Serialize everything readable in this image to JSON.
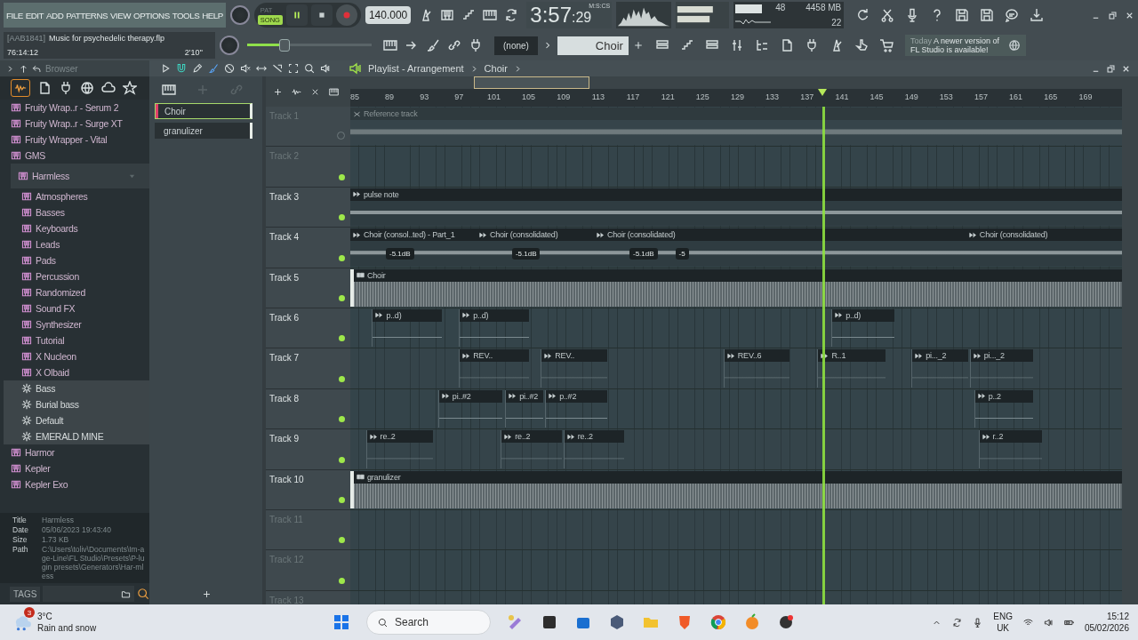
{
  "menu": [
    "FILE",
    "EDIT",
    "ADD",
    "PATTERNS",
    "VIEW",
    "OPTIONS",
    "TOOLS",
    "HELP"
  ],
  "project": {
    "code": "[AAB1841]",
    "name": "Music for psychedelic therapy.flp",
    "time": "76:14:12",
    "length": "2'10''"
  },
  "transport": {
    "modes": [
      {
        "label": "PAT",
        "selected": false
      },
      {
        "label": "SONG",
        "selected": true
      }
    ],
    "playing": true,
    "tempo": "140.000",
    "slider": {
      "level": 0.3
    }
  },
  "clock": {
    "main": "3:57",
    "small": ":29",
    "unit": "M:S:CS"
  },
  "monitor": {
    "voices": "48",
    "memory": "4458 MB",
    "cpu": "22"
  },
  "pattern": {
    "selector": "(none)",
    "current": "Choir"
  },
  "news": {
    "when": "Today",
    "text": "A newer version of FL Studio is available!"
  },
  "browser": {
    "title": "Browser",
    "items": [
      {
        "label": "Fruity Wrap..r - Serum 2",
        "kind": "plugin",
        "selected": false
      },
      {
        "label": "Fruity Wrap..r - Surge XT",
        "kind": "plugin",
        "selected": false
      },
      {
        "label": "Fruity Wrapper - Vital",
        "kind": "plugin",
        "selected": false
      },
      {
        "label": "GMS",
        "kind": "plugin",
        "selected": false
      },
      {
        "label": "Harmless",
        "kind": "plugin",
        "selected": true,
        "expanded": true,
        "children": [
          {
            "label": "Atmospheres",
            "kind": "plugin",
            "selected": false
          },
          {
            "label": "Basses",
            "kind": "plugin",
            "selected": false
          },
          {
            "label": "Keyboards",
            "kind": "plugin",
            "selected": false
          },
          {
            "label": "Leads",
            "kind": "plugin",
            "selected": false
          },
          {
            "label": "Pads",
            "kind": "plugin",
            "selected": false
          },
          {
            "label": "Percussion",
            "kind": "plugin",
            "selected": false
          },
          {
            "label": "Randomized",
            "kind": "plugin",
            "selected": false
          },
          {
            "label": "Sound FX",
            "kind": "plugin",
            "selected": false
          },
          {
            "label": "Synthesizer",
            "kind": "plugin",
            "selected": false
          },
          {
            "label": "Tutorial",
            "kind": "plugin",
            "selected": false
          },
          {
            "label": "X Nucleon",
            "kind": "plugin",
            "selected": false
          },
          {
            "label": "X Olbaid",
            "kind": "plugin",
            "selected": false
          },
          {
            "label": "Bass",
            "kind": "preset",
            "selected": false
          },
          {
            "label": "Burial bass",
            "kind": "preset",
            "selected": false
          },
          {
            "label": "Default",
            "kind": "preset",
            "selected": false
          },
          {
            "label": "EMERALD MINE",
            "kind": "preset",
            "selected": false
          }
        ]
      },
      {
        "label": "Harmor",
        "kind": "plugin",
        "selected": false
      },
      {
        "label": "Kepler",
        "kind": "plugin",
        "selected": false
      },
      {
        "label": "Kepler Exo",
        "kind": "plugin",
        "selected": false
      }
    ],
    "info": [
      {
        "label": "Title",
        "value": "Harmless"
      },
      {
        "label": "Date",
        "value": "05/06/2023 19:43:40"
      },
      {
        "label": "Size",
        "value": "1.73 KB"
      },
      {
        "label": "Path",
        "value": "C:\\Users\\toliv\\Documents\\Im-age-Line\\FL Studio\\Presets\\P-lugin presets\\Generators\\Har-mless"
      }
    ],
    "tags": "TAGS"
  },
  "picker": [
    {
      "name": "Choir",
      "selected": true
    },
    {
      "name": "granulizer",
      "selected": false
    }
  ],
  "playlist": {
    "title": "Playlist - Arrangement",
    "crumb": "Choir",
    "ruler": [
      "85",
      "89",
      "93",
      "97",
      "101",
      "105",
      "109",
      "113",
      "117",
      "121",
      "125",
      "129",
      "133",
      "137",
      "141",
      "145",
      "149",
      "153",
      "157",
      "161",
      "165",
      "169"
    ],
    "tracks": [
      {
        "name": "Track 1",
        "muted": true,
        "clips": [
          {
            "kind": "audio",
            "label": "Reference track"
          }
        ]
      },
      {
        "name": "Track 2",
        "muted": false
      },
      {
        "name": "Track 3",
        "muted": false,
        "clips": [
          {
            "kind": "audio",
            "label": "pulse note"
          }
        ]
      },
      {
        "name": "Track 4",
        "muted": false,
        "clips": [
          {
            "kind": "audio",
            "label": "Choir (consol..ted) - Part_1",
            "badges": [
              "-5.1dB"
            ]
          },
          {
            "kind": "audio",
            "label": "Choir (consolidated)",
            "badges": [
              "-5.1dB"
            ]
          },
          {
            "kind": "audio",
            "label": "Choir (consolidated)",
            "badges": [
              "-5.1dB",
              "-5"
            ]
          },
          {
            "kind": "audio",
            "label": "Choir (consolidated)"
          }
        ]
      },
      {
        "name": "Track 5",
        "muted": false,
        "clips": [
          {
            "kind": "dense",
            "label": "Choir"
          }
        ]
      },
      {
        "name": "Track 6",
        "muted": false,
        "clips": [
          {
            "kind": "pattern",
            "label": "p..d)"
          },
          {
            "kind": "pattern",
            "label": "p..d)"
          },
          {
            "kind": "pattern",
            "label": "p..d)"
          }
        ]
      },
      {
        "name": "Track 7",
        "muted": false,
        "clips": [
          {
            "kind": "pattern",
            "label": "REV.."
          },
          {
            "kind": "pattern",
            "label": "REV.."
          },
          {
            "kind": "pattern",
            "label": "REV..6"
          },
          {
            "kind": "pattern",
            "label": "R..1"
          },
          {
            "kind": "pattern",
            "label": "pi..._2"
          },
          {
            "kind": "pattern",
            "label": "pi..._2"
          }
        ]
      },
      {
        "name": "Track 8",
        "muted": false,
        "clips": [
          {
            "kind": "pattern",
            "label": "pi..#2"
          },
          {
            "kind": "pattern",
            "label": "pi..#2"
          },
          {
            "kind": "pattern",
            "label": "p..#2"
          },
          {
            "kind": "pattern",
            "label": "p..2"
          }
        ]
      },
      {
        "name": "Track 9",
        "muted": false,
        "clips": [
          {
            "kind": "pattern",
            "label": "re..2"
          },
          {
            "kind": "pattern",
            "label": "re..2"
          },
          {
            "kind": "pattern",
            "label": "re..2"
          },
          {
            "kind": "pattern",
            "label": "r..2"
          }
        ]
      },
      {
        "name": "Track 10",
        "muted": false,
        "clips": [
          {
            "kind": "dense",
            "label": "granulizer"
          }
        ]
      },
      {
        "name": "Track 11",
        "muted": false
      },
      {
        "name": "Track 12",
        "muted": false
      },
      {
        "name": "Track 13",
        "muted": false
      }
    ]
  },
  "taskbar": {
    "weather": {
      "badge": "3",
      "temp": "3°C",
      "text": "Rain and snow"
    },
    "search": "Search",
    "lang": "ENG",
    "region": "UK",
    "time": "15:12",
    "date": "05/02/2026"
  }
}
